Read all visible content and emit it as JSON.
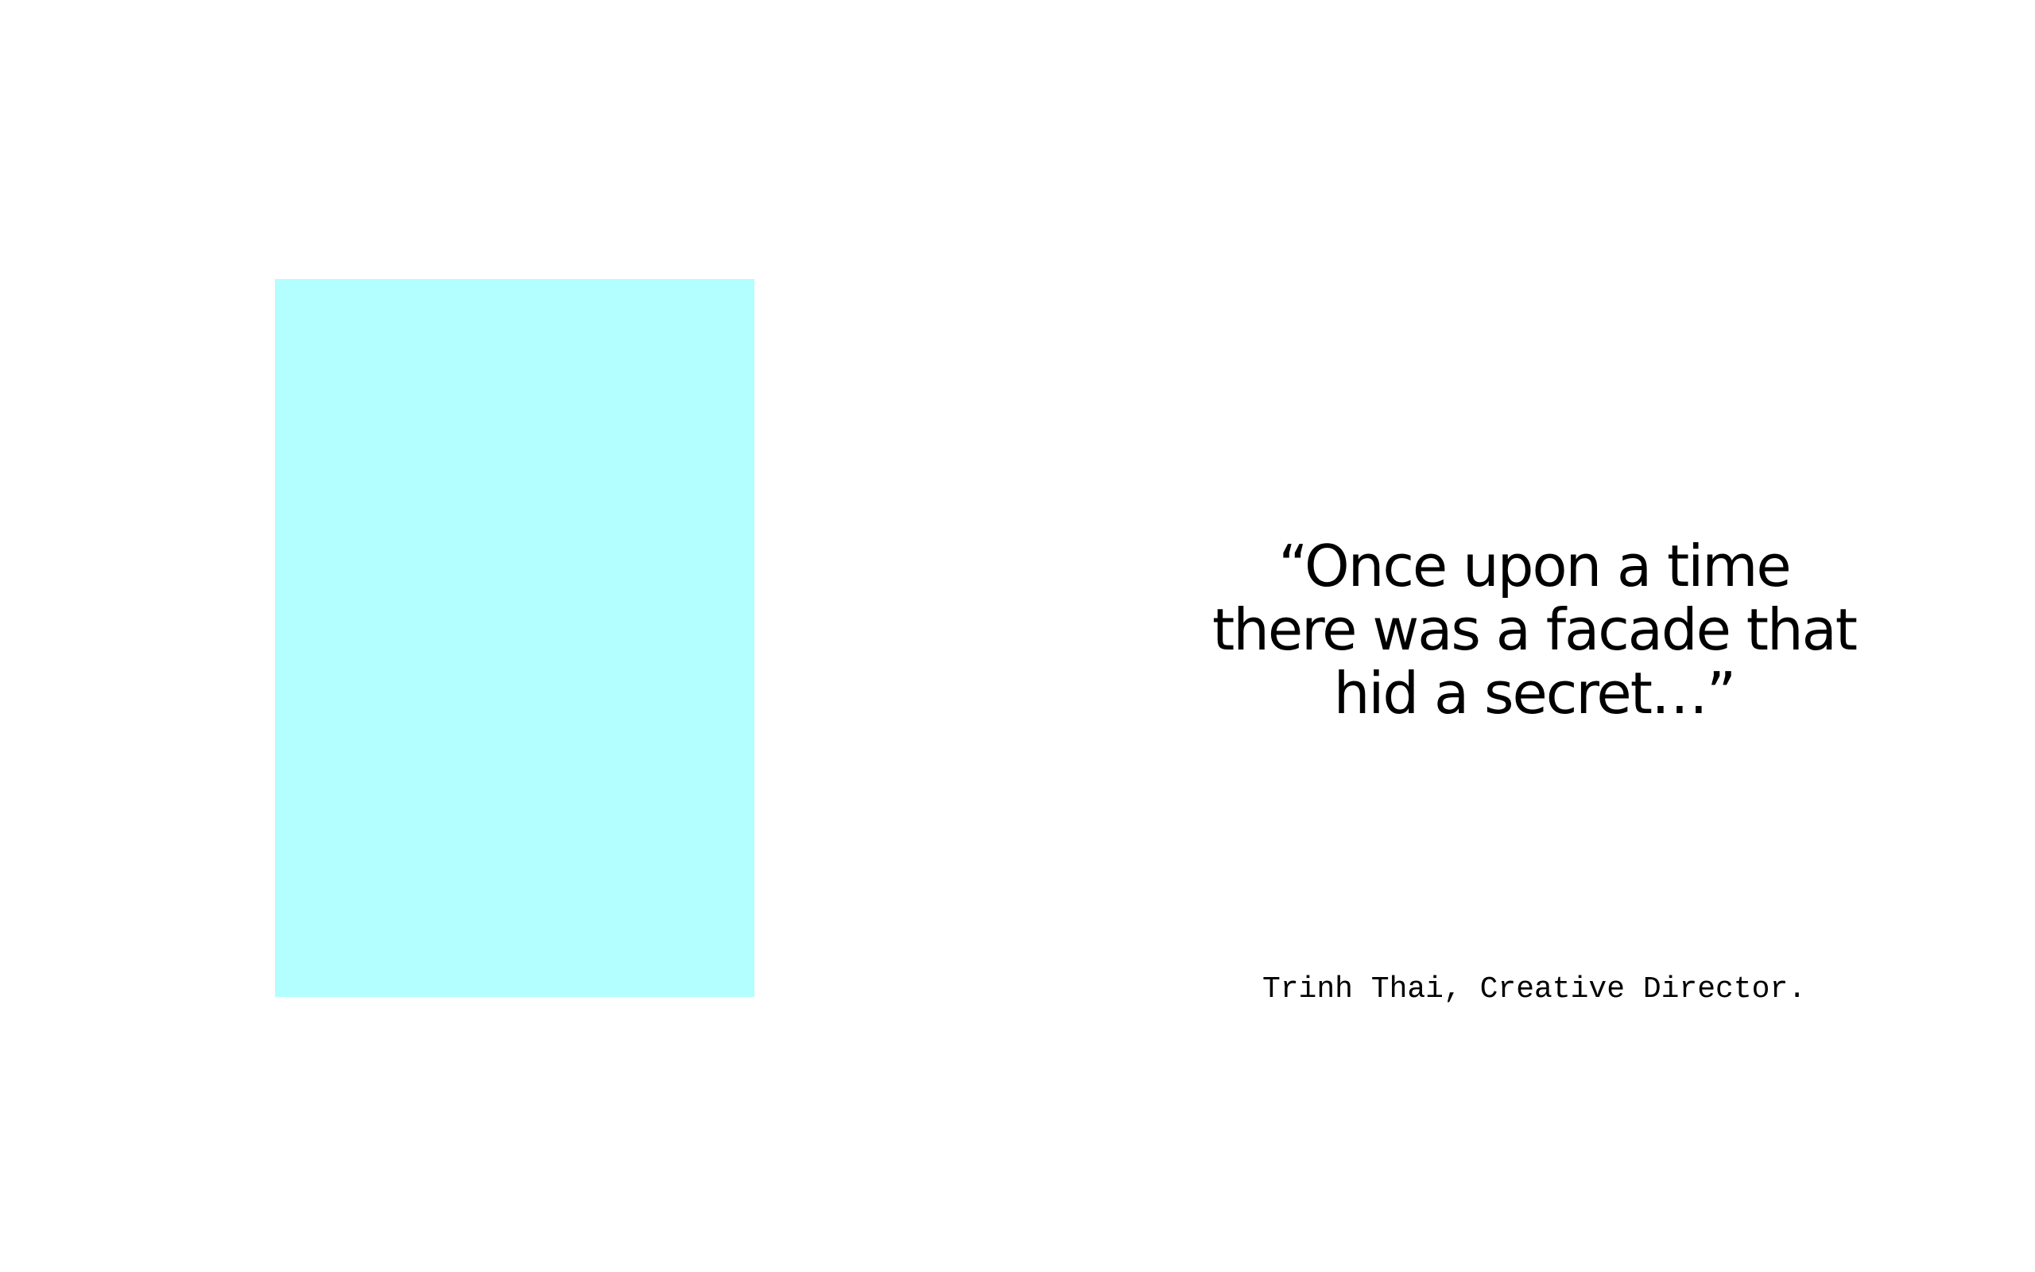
{
  "colors": {
    "background": "#ffffff",
    "image_placeholder": "#b3ffff",
    "text": "#000000"
  },
  "quote": {
    "lines": [
      "“Once upon a time",
      "there was a facade that",
      "hid a secret…”"
    ]
  },
  "attribution": "Trinh Thai, Creative Director."
}
